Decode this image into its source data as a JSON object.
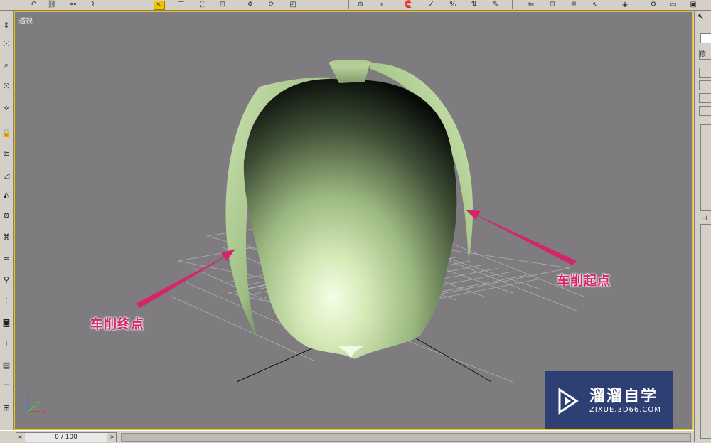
{
  "viewport": {
    "label": "透视",
    "callout_end": "车削终点",
    "callout_start": "车削起点",
    "accent_border": "#f2c400",
    "callout_color": "#d6236a"
  },
  "statusbar": {
    "frame": "0 / 100"
  },
  "right_panel": {
    "tab_modify": "修"
  },
  "watermark": {
    "name": "溜溜自学",
    "url": "ZIXUE.3D66.COM"
  },
  "axis": {
    "x": "x",
    "y": "y",
    "z": "z"
  }
}
